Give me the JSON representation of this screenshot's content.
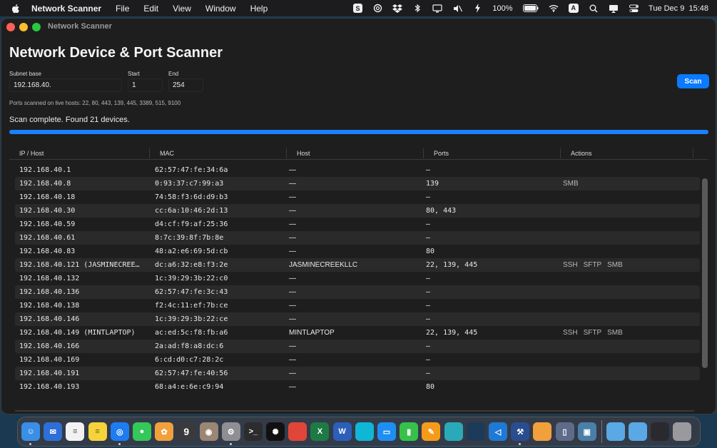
{
  "menubar": {
    "app_name": "Network Scanner",
    "menus": [
      "File",
      "Edit",
      "View",
      "Window",
      "Help"
    ],
    "battery": "100%",
    "input_source": "A",
    "datetime": "Tue Dec 9  15:48"
  },
  "window": {
    "title": "Network Scanner",
    "heading": "Network Device & Port Scanner",
    "subnet_label": "Subnet base",
    "subnet_value": "192.168.40.",
    "start_label": "Start",
    "start_value": "1",
    "end_label": "End",
    "end_value": "254",
    "scan_label": "Scan",
    "ports_note": "Ports scanned on live hosts: 22, 80, 443, 139, 445, 3389, 515, 9100",
    "status": "Scan complete. Found 21 devices.",
    "progress": 1.0
  },
  "table": {
    "headers": [
      "IP / Host",
      "MAC",
      "Host",
      "Ports",
      "Actions"
    ],
    "rows": [
      {
        "ip": "192.168.40.1",
        "mac": "62:57:47:fe:34:6a",
        "host": "—",
        "ports": "—",
        "actions": []
      },
      {
        "ip": "192.168.40.8",
        "mac": "0:93:37:c7:99:a3",
        "host": "—",
        "ports": "139",
        "actions": [
          "SMB"
        ]
      },
      {
        "ip": "192.168.40.18",
        "mac": "74:58:f3:6d:d9:b3",
        "host": "—",
        "ports": "—",
        "actions": []
      },
      {
        "ip": "192.168.40.30",
        "mac": "cc:6a:10:46:2d:13",
        "host": "—",
        "ports": "80, 443",
        "actions": []
      },
      {
        "ip": "192.168.40.59",
        "mac": "d4:cf:f9:af:25:36",
        "host": "—",
        "ports": "—",
        "actions": []
      },
      {
        "ip": "192.168.40.61",
        "mac": "8:7c:39:8f:7b:8e",
        "host": "—",
        "ports": "—",
        "actions": []
      },
      {
        "ip": "192.168.40.83",
        "mac": "48:a2:e6:69:5d:cb",
        "host": "—",
        "ports": "80",
        "actions": []
      },
      {
        "ip": "192.168.40.121 (JASMINECREE…",
        "mac": "dc:a6:32:e8:f3:2e",
        "host": "JASMINECREEKLLC",
        "ports": "22, 139, 445",
        "actions": [
          "SSH",
          "SFTP",
          "SMB"
        ]
      },
      {
        "ip": "192.168.40.132",
        "mac": "1c:39:29:3b:22:c0",
        "host": "—",
        "ports": "—",
        "actions": []
      },
      {
        "ip": "192.168.40.136",
        "mac": "62:57:47:fe:3c:43",
        "host": "—",
        "ports": "—",
        "actions": []
      },
      {
        "ip": "192.168.40.138",
        "mac": "f2:4c:11:ef:7b:ce",
        "host": "—",
        "ports": "—",
        "actions": []
      },
      {
        "ip": "192.168.40.146",
        "mac": "1c:39:29:3b:22:ce",
        "host": "—",
        "ports": "—",
        "actions": []
      },
      {
        "ip": "192.168.40.149 (MINTLAPTOP)",
        "mac": "ac:ed:5c:f8:fb:a6",
        "host": "MINTLAPTOP",
        "ports": "22, 139, 445",
        "actions": [
          "SSH",
          "SFTP",
          "SMB"
        ]
      },
      {
        "ip": "192.168.40.166",
        "mac": "2a:ad:f8:a8:dc:6",
        "host": "—",
        "ports": "—",
        "actions": []
      },
      {
        "ip": "192.168.40.169",
        "mac": "6:cd:d0:c7:28:2c",
        "host": "—",
        "ports": "—",
        "actions": []
      },
      {
        "ip": "192.168.40.191",
        "mac": "62:57:47:fe:40:56",
        "host": "—",
        "ports": "—",
        "actions": []
      },
      {
        "ip": "192.168.40.193",
        "mac": "68:a4:e:6e:c9:94",
        "host": "—",
        "ports": "80",
        "actions": []
      }
    ]
  },
  "dock": {
    "calendar_day": "9",
    "apps": [
      {
        "name": "finder-icon",
        "color": "#3a8ee6",
        "running": true
      },
      {
        "name": "mail-icon",
        "color": "#2d6fd6",
        "running": false
      },
      {
        "name": "reminders-icon",
        "color": "#f2f2f2",
        "running": false
      },
      {
        "name": "notes-icon",
        "color": "#f5d33b",
        "running": false
      },
      {
        "name": "safari-icon",
        "color": "#1e7cf2",
        "running": true
      },
      {
        "name": "messages-icon",
        "color": "#34c759",
        "running": false
      },
      {
        "name": "photos-icon",
        "color": "#f2a03b",
        "running": false
      },
      {
        "name": "calendar-icon",
        "color": "#3a3a3c",
        "running": false
      },
      {
        "name": "contacts-icon",
        "color": "#9a8672",
        "running": false
      },
      {
        "name": "system-settings-icon",
        "color": "#8e8e93",
        "running": true
      },
      {
        "name": "terminal-icon",
        "color": "#2c2c2e",
        "running": false
      },
      {
        "name": "chatgpt-icon",
        "color": "#111111",
        "running": false
      },
      {
        "name": "app-red-icon",
        "color": "#e0453a",
        "running": false
      },
      {
        "name": "excel-icon",
        "color": "#1d7a45",
        "running": false
      },
      {
        "name": "word-icon",
        "color": "#2b5fb8",
        "running": false
      },
      {
        "name": "app-cyan-icon",
        "color": "#0fb6d6",
        "running": false
      },
      {
        "name": "keynote-icon",
        "color": "#1e8ff2",
        "running": false
      },
      {
        "name": "numbers-icon",
        "color": "#36c14a",
        "running": false
      },
      {
        "name": "pages-icon",
        "color": "#f59b1b",
        "running": false
      },
      {
        "name": "app-teal-icon",
        "color": "#2aa9b8",
        "running": false
      },
      {
        "name": "xcode-devtools-icon",
        "color": "#1c3b5a",
        "running": false
      },
      {
        "name": "vscode-icon",
        "color": "#1f7ad6",
        "running": false
      },
      {
        "name": "xcode-icon",
        "color": "#2a4d8f",
        "running": true
      },
      {
        "name": "app-stripes-icon",
        "color": "#f2a03b",
        "running": false
      },
      {
        "name": "app-files-icon",
        "color": "#5e6c8a",
        "running": false
      },
      {
        "name": "app-preview-icon",
        "color": "#4a7fa8",
        "running": false
      }
    ],
    "stack": [
      {
        "name": "folder-apps-icon",
        "color": "#5aa8e6"
      },
      {
        "name": "folder-downloads-icon",
        "color": "#5aa8e6"
      },
      {
        "name": "screenshot-stack-icon",
        "color": "#2a2a2e"
      },
      {
        "name": "trash-icon",
        "color": "#9a9a9e"
      }
    ]
  }
}
